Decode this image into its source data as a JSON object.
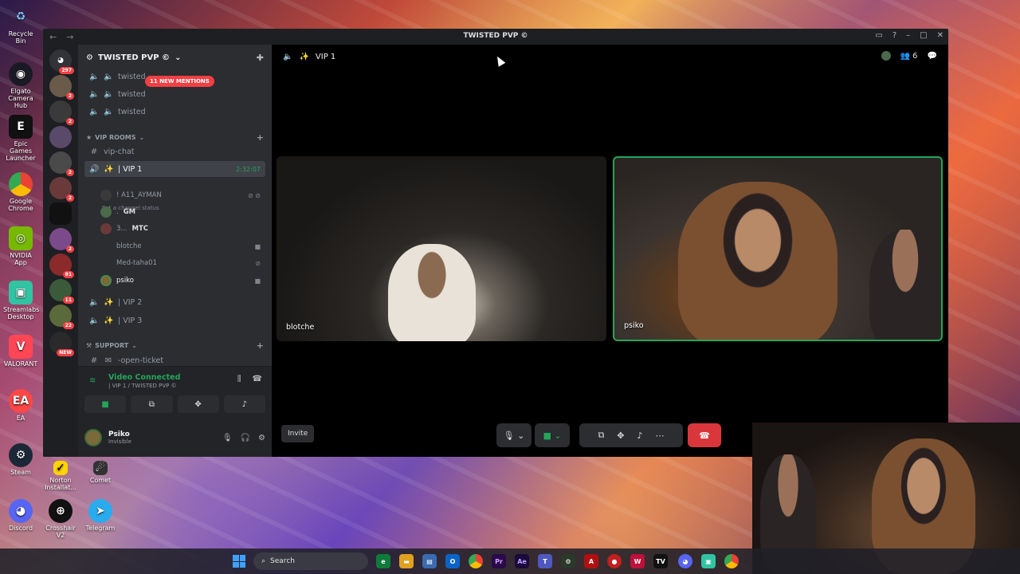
{
  "window": {
    "title": "TWISTED PVP ©"
  },
  "desktop": {
    "icons": [
      {
        "label": "Recycle Bin",
        "icon": "recycle-bin-icon"
      },
      {
        "label": "Elgato Camera Hub",
        "icon": "camera-icon"
      },
      {
        "label": "Epic Games Launcher",
        "icon": "epic-games-icon"
      },
      {
        "label": "Google Chrome",
        "icon": "chrome-icon"
      },
      {
        "label": "NVIDIA App",
        "icon": "nvidia-icon"
      },
      {
        "label": "Streamlabs Desktop",
        "icon": "streamlabs-icon"
      },
      {
        "label": "VALORANT",
        "icon": "valorant-icon"
      },
      {
        "label": "EA",
        "icon": "ea-icon"
      },
      {
        "label": "Steam",
        "icon": "steam-icon"
      },
      {
        "label": "Discord",
        "icon": "discord-icon"
      }
    ],
    "bottom_icons": [
      {
        "label": "Norton Installat...",
        "icon": "norton-icon"
      },
      {
        "label": "Comet",
        "icon": "comet-icon"
      },
      {
        "label": "Crosshair V2",
        "icon": "crosshair-icon"
      },
      {
        "label": "Telegram",
        "icon": "telegram-icon"
      }
    ]
  },
  "server_rail": {
    "home_badge": "297",
    "badges": [
      "2",
      "2",
      "2",
      "2",
      "2",
      "81",
      "11",
      "22",
      "2"
    ],
    "new_label": "NEW"
  },
  "guild": {
    "name": "TWISTED PVP ©",
    "mentions_pill": "11 NEW MENTIONS",
    "top_channels": [
      "twisted",
      "twisted",
      "twisted"
    ],
    "category_vip": "VIP ROOMS",
    "text_channel": "vip-chat",
    "active_voice": {
      "name": "| VIP 1",
      "timer": "2:32:07",
      "status": "Set a channel status"
    },
    "members": [
      {
        "name": "! A11_AYMAN",
        "activity": ""
      },
      {
        "name": ".",
        "activity": "GM"
      },
      {
        "name": "3...",
        "activity": "MTC"
      },
      {
        "name": "blotche",
        "activity": ""
      },
      {
        "name": "Med-taha01",
        "activity": ""
      },
      {
        "name": "psiko",
        "activity": ""
      }
    ],
    "other_voice": [
      "| VIP 2",
      "| VIP 3"
    ],
    "category_support": "SUPPORT",
    "support_channel": "-open-ticket"
  },
  "voice_panel": {
    "title": "Video Connected",
    "subtitle": "| VIP 1 / TWISTED PVP ©"
  },
  "user": {
    "name": "Psiko",
    "status": "Invisible"
  },
  "stage": {
    "channel": "VIP 1",
    "participant_count": "6",
    "tiles": [
      {
        "name": "blotche"
      },
      {
        "name": "psiko"
      }
    ],
    "invite_label": "Invite"
  },
  "taskbar": {
    "search_placeholder": "Search"
  },
  "colors": {
    "accent_green": "#23a55a",
    "end_call_red": "#da373c",
    "mention_red": "#f23f43"
  }
}
